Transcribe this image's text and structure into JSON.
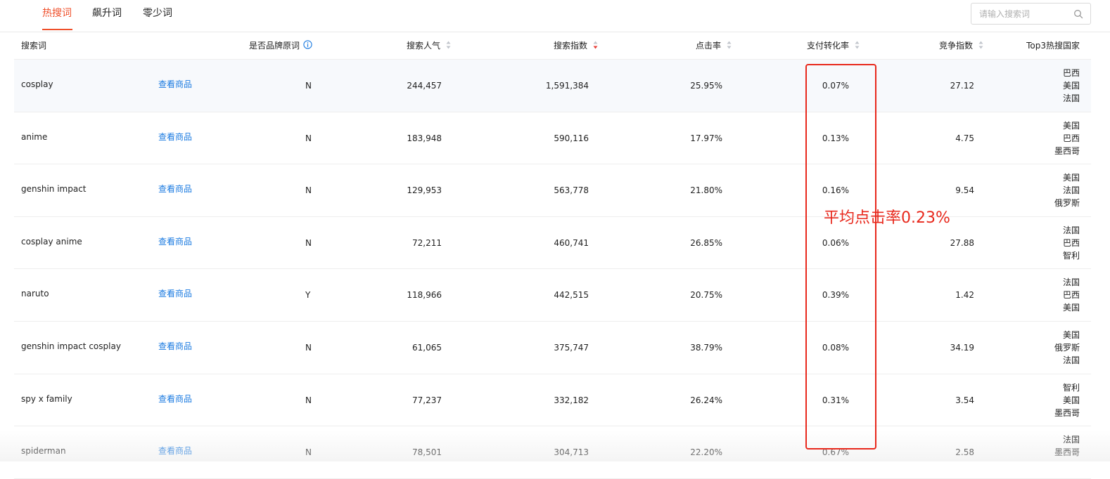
{
  "tabs": [
    {
      "label": "热搜词",
      "active": true
    },
    {
      "label": "飙升词",
      "active": false
    },
    {
      "label": "零少词",
      "active": false
    }
  ],
  "search": {
    "placeholder": "请输入搜索词",
    "value": ""
  },
  "table": {
    "columns": {
      "keyword": "搜索词",
      "brand": "是否品牌原词",
      "popularity": "搜索人气",
      "search_index": "搜索指数",
      "ctr": "点击率",
      "conversion": "支付转化率",
      "competition": "竞争指数",
      "countries": "Top3热搜国家"
    },
    "sort": {
      "column": "search_index",
      "direction": "descending"
    },
    "view_label": "查看商品",
    "rows": [
      {
        "keyword": "cosplay",
        "brand": "N",
        "popularity": "244,457",
        "search_index": "1,591,384",
        "ctr": "25.95%",
        "conversion": "0.07%",
        "competition": "27.12",
        "countries": [
          "巴西",
          "美国",
          "法国"
        ]
      },
      {
        "keyword": "anime",
        "brand": "N",
        "popularity": "183,948",
        "search_index": "590,116",
        "ctr": "17.97%",
        "conversion": "0.13%",
        "competition": "4.75",
        "countries": [
          "美国",
          "巴西",
          "墨西哥"
        ]
      },
      {
        "keyword": "genshin impact",
        "brand": "N",
        "popularity": "129,953",
        "search_index": "563,778",
        "ctr": "21.80%",
        "conversion": "0.16%",
        "competition": "9.54",
        "countries": [
          "美国",
          "法国",
          "俄罗斯"
        ]
      },
      {
        "keyword": "cosplay anime",
        "brand": "N",
        "popularity": "72,211",
        "search_index": "460,741",
        "ctr": "26.85%",
        "conversion": "0.06%",
        "competition": "27.88",
        "countries": [
          "法国",
          "巴西",
          "智利"
        ]
      },
      {
        "keyword": "naruto",
        "brand": "Y",
        "popularity": "118,966",
        "search_index": "442,515",
        "ctr": "20.75%",
        "conversion": "0.39%",
        "competition": "1.42",
        "countries": [
          "法国",
          "巴西",
          "美国"
        ]
      },
      {
        "keyword": "genshin impact cosplay",
        "brand": "N",
        "popularity": "61,065",
        "search_index": "375,747",
        "ctr": "38.79%",
        "conversion": "0.08%",
        "competition": "34.19",
        "countries": [
          "美国",
          "俄罗斯",
          "法国"
        ]
      },
      {
        "keyword": "spy x family",
        "brand": "N",
        "popularity": "77,237",
        "search_index": "332,182",
        "ctr": "26.24%",
        "conversion": "0.31%",
        "competition": "3.54",
        "countries": [
          "智利",
          "美国",
          "墨西哥"
        ]
      },
      {
        "keyword": "spiderman",
        "brand": "N",
        "popularity": "78,501",
        "search_index": "304,713",
        "ctr": "22.20%",
        "conversion": "0.67%",
        "competition": "2.58",
        "countries": [
          "法国",
          "墨西哥"
        ]
      }
    ]
  },
  "annotation": {
    "text": "平均点击率0.23%",
    "color": "#e8281c"
  },
  "colors": {
    "accent": "#ef4f2a",
    "link": "#1a7ae0",
    "sort_active": "#e8403a",
    "sort_inactive": "#c2c6cc"
  },
  "icons": {
    "search": "search-icon",
    "info": "info-icon",
    "sort": "sort-icon"
  }
}
